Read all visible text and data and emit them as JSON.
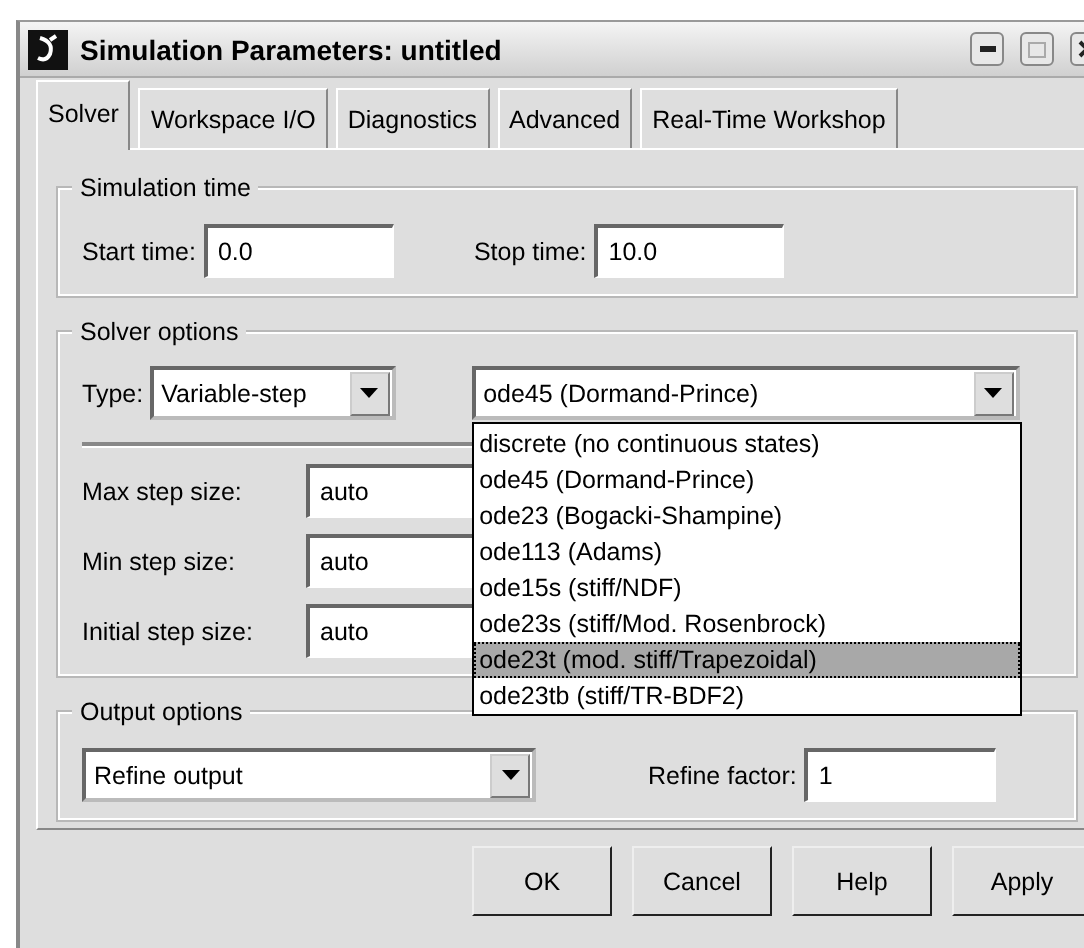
{
  "window": {
    "title": "Simulation Parameters: untitled"
  },
  "tabs": [
    {
      "label": "Solver",
      "selected": true
    },
    {
      "label": "Workspace I/O",
      "selected": false
    },
    {
      "label": "Diagnostics",
      "selected": false
    },
    {
      "label": "Advanced",
      "selected": false
    },
    {
      "label": "Real-Time Workshop",
      "selected": false
    }
  ],
  "simulation_time": {
    "title": "Simulation time",
    "fields": [
      {
        "label": "Start time:",
        "value": "0.0"
      },
      {
        "label": "Stop time:",
        "value": "10.0"
      }
    ]
  },
  "solver_options": {
    "title": "Solver options",
    "type_label": "Type:",
    "type_value": "Variable-step",
    "solver_value": "ode45 (Dormand-Prince)",
    "solver_list": [
      {
        "label": "discrete (no continuous states)",
        "selected": false
      },
      {
        "label": "ode45 (Dormand-Prince)",
        "selected": false
      },
      {
        "label": "ode23 (Bogacki-Shampine)",
        "selected": false
      },
      {
        "label": "ode113 (Adams)",
        "selected": false
      },
      {
        "label": "ode15s (stiff/NDF)",
        "selected": false
      },
      {
        "label": "ode23s (stiff/Mod. Rosenbrock)",
        "selected": false
      },
      {
        "label": "ode23t (mod. stiff/Trapezoidal)",
        "selected": true
      },
      {
        "label": "ode23tb (stiff/TR-BDF2)",
        "selected": false
      }
    ],
    "step_fields": [
      {
        "label": "Max step size:",
        "value": "auto"
      },
      {
        "label": "Min step size:",
        "value": "auto"
      },
      {
        "label": "Initial step size:",
        "value": "auto"
      }
    ]
  },
  "output_options": {
    "title": "Output options",
    "mode": "Refine output",
    "refine_factor": {
      "label": "Refine factor:",
      "value": "1"
    }
  },
  "buttons": [
    "OK",
    "Cancel",
    "Help",
    "Apply"
  ]
}
